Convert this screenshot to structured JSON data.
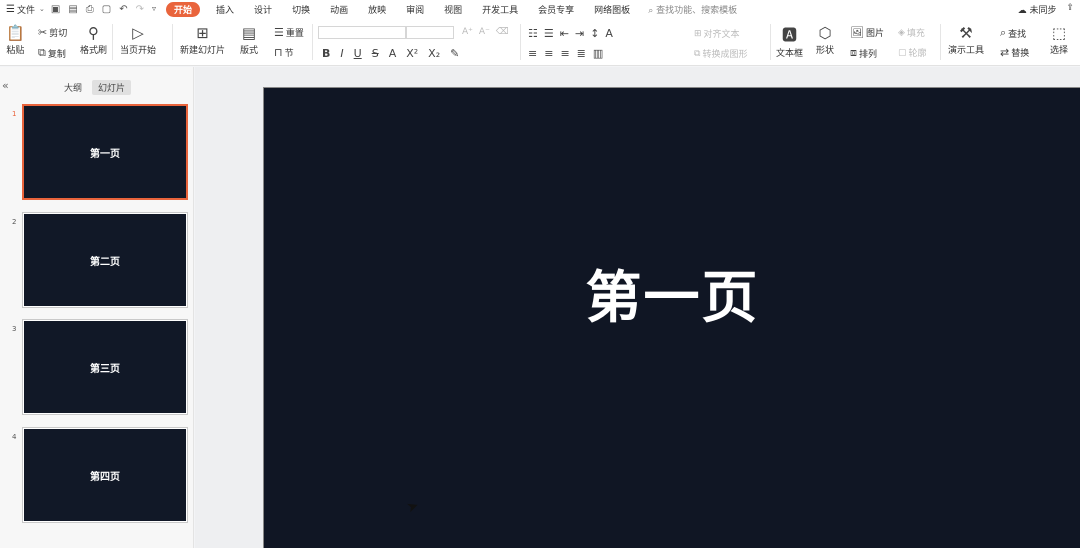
{
  "menu": {
    "hamburger_icon": "hamburger-icon",
    "file_label": "文件",
    "tabs": [
      "插入",
      "设计",
      "切换",
      "动画",
      "放映",
      "审阅",
      "视图",
      "开发工具",
      "会员专享",
      "网络图板"
    ],
    "active_tab": "开始",
    "search_placeholder": "查找功能、搜索模板",
    "unsync_label": "未同步",
    "share_icon": "share-icon"
  },
  "ribbon": {
    "paste": "粘贴",
    "cut": "剪切",
    "copy": "复制",
    "format_painter": "格式刷",
    "from_current": "当页开始",
    "new_slide": "新建幻灯片",
    "layout": "版式",
    "section": "节",
    "reset": "重置",
    "text_direction": "对齐文本",
    "convert_smartart": "转换成图形",
    "text_box": "文本框",
    "shape": "形状",
    "picture": "图片",
    "fill": "填充",
    "arrange": "排列",
    "outline": "轮廓",
    "presentation_tools": "演示工具",
    "find": "查找",
    "replace": "替换",
    "select": "选择"
  },
  "sidebar": {
    "tab_outline": "大纲",
    "tab_slides": "幻灯片",
    "slides": [
      {
        "num": "1",
        "title": "第一页",
        "active": true
      },
      {
        "num": "2",
        "title": "第二页",
        "active": false
      },
      {
        "num": "3",
        "title": "第三页",
        "active": false
      },
      {
        "num": "4",
        "title": "第四页",
        "active": false
      }
    ]
  },
  "main_slide": {
    "title": "第一页",
    "background": "#101624"
  },
  "colors": {
    "accent": "#e9643c",
    "slide_bg": "#111827"
  }
}
